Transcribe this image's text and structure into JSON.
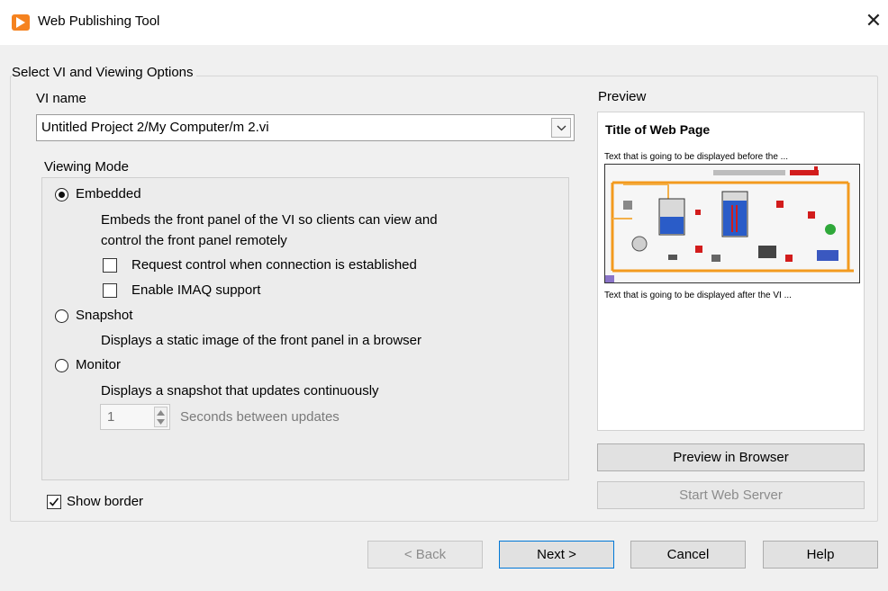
{
  "window": {
    "title": "Web Publishing Tool",
    "app_icon": "labview-run-arrow-icon",
    "close_glyph": "✕"
  },
  "group": {
    "title": "Select VI and Viewing Options"
  },
  "vi_name": {
    "label": "VI name",
    "value": "Untitled Project 2/My Computer/m 2.vi"
  },
  "viewing_mode": {
    "label": "Viewing Mode",
    "embedded": {
      "label": "Embedded",
      "selected": true,
      "description_line1": "Embeds the front panel of the VI so clients can view and",
      "description_line2": "control the front panel remotely",
      "request_control_label": "Request control when connection is established",
      "request_control_checked": false,
      "imaq_label": "Enable IMAQ support",
      "imaq_checked": false
    },
    "snapshot": {
      "label": "Snapshot",
      "selected": false,
      "description": "Displays a static image of the front panel in a browser"
    },
    "monitor": {
      "label": "Monitor",
      "selected": false,
      "description": "Displays a snapshot that updates continuously",
      "seconds_value": "1",
      "seconds_label": "Seconds between updates"
    }
  },
  "show_border": {
    "label": "Show border",
    "checked": true
  },
  "preview": {
    "label": "Preview",
    "page_title": "Title of Web Page",
    "text_before": "Text that is going to be displayed before the ...",
    "text_after": "Text that is going to be displayed after the VI ..."
  },
  "buttons": {
    "preview_in_browser": "Preview in Browser",
    "start_web_server": "Start Web Server",
    "back": "< Back",
    "next": "Next >",
    "cancel": "Cancel",
    "help": "Help"
  },
  "colors": {
    "accent": "#0078d7",
    "app_icon": "#f5821f",
    "window_bg": "#f0f0f0"
  }
}
